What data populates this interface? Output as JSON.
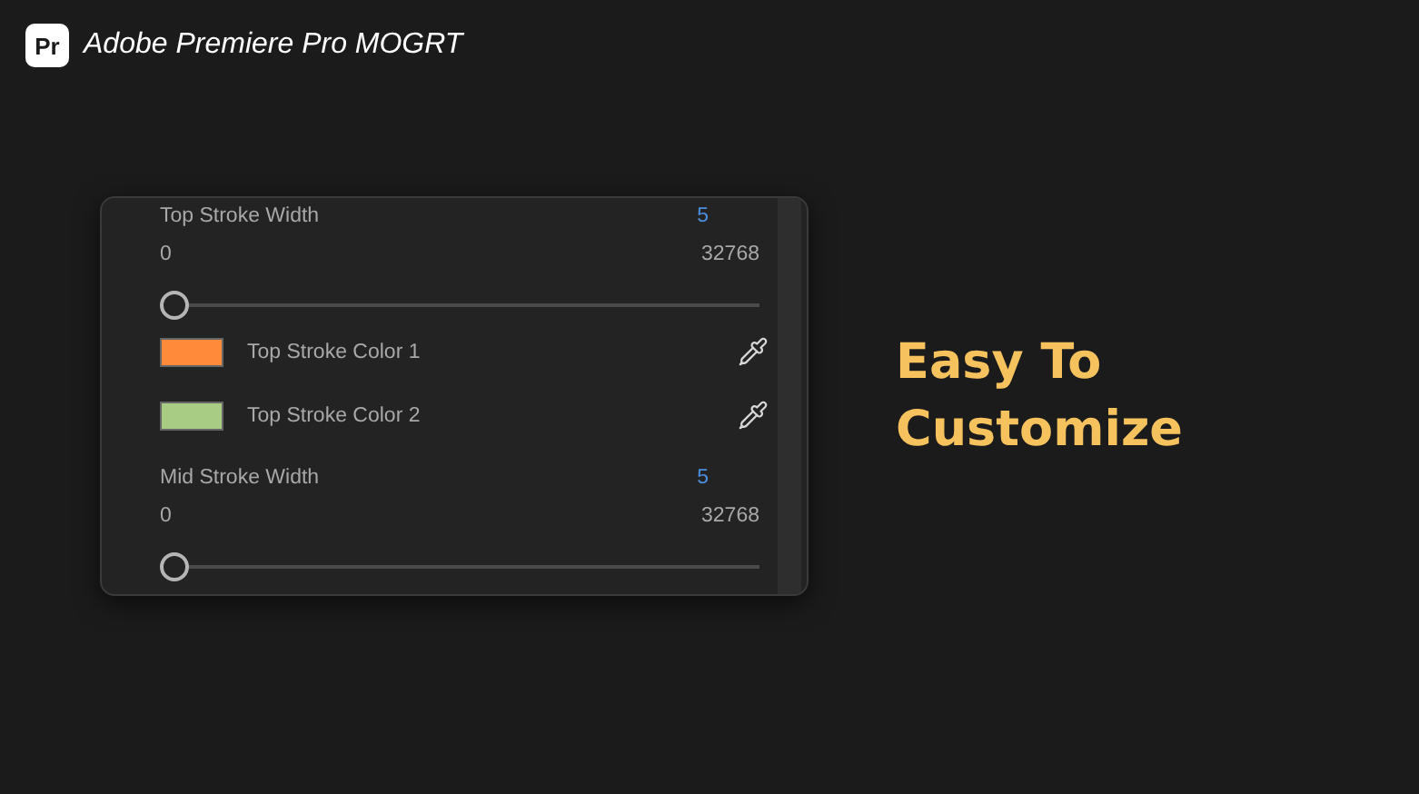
{
  "header": {
    "logo": "Pr",
    "title": "Adobe Premiere Pro MOGRT"
  },
  "panel": {
    "items": [
      {
        "kind": "slider",
        "label": "Top Stroke Width",
        "value": "5",
        "min": "0",
        "max": "32768",
        "level": 0
      },
      {
        "kind": "color",
        "label": "Top Stroke Color 1",
        "color": "#ff8a3a"
      },
      {
        "kind": "color",
        "label": "Top Stroke Color 2",
        "color": "#a8cc84"
      },
      {
        "kind": "slider",
        "label": "Mid Stroke Width",
        "value": "5",
        "min": "0",
        "max": "32768",
        "level": 0
      }
    ]
  },
  "headline": [
    "Easy To",
    "Customize"
  ]
}
